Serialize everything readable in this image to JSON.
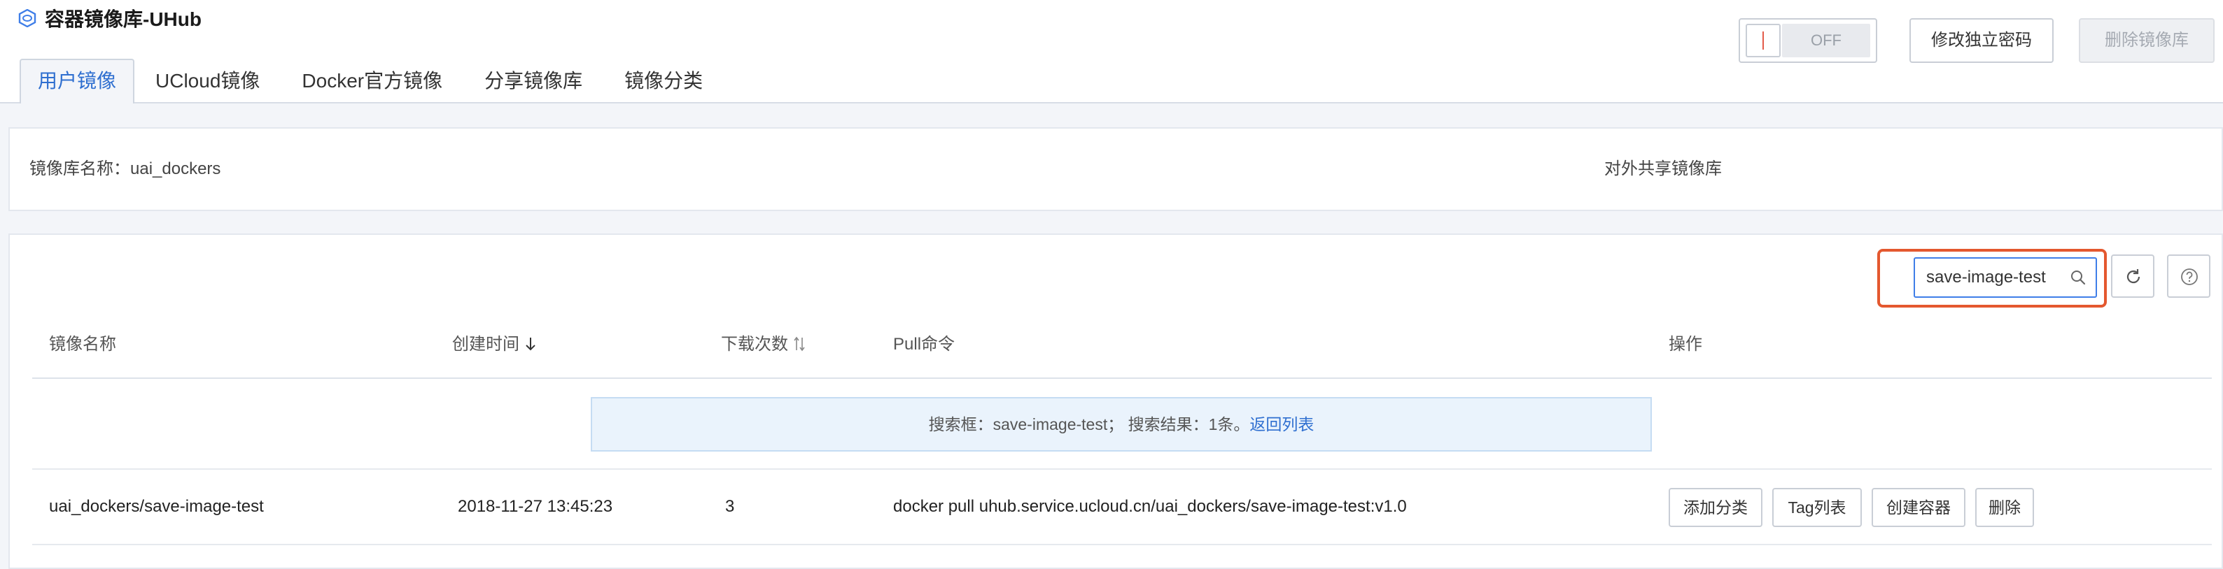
{
  "app": {
    "title": "容器镜像库-UHub"
  },
  "tabs": [
    {
      "label": "用户镜像",
      "active": true
    },
    {
      "label": "UCloud镜像"
    },
    {
      "label": "Docker官方镜像"
    },
    {
      "label": "分享镜像库"
    },
    {
      "label": "镜像分类"
    }
  ],
  "repo": {
    "name_label": "镜像库名称：uai_dockers",
    "share_label": "对外共享镜像库",
    "toggle_state": "OFF",
    "change_password_label": "修改独立密码",
    "delete_repo_label": "删除镜像库"
  },
  "search": {
    "value": "save-image-test",
    "icon": "search-icon"
  },
  "toolbar": {
    "refresh_icon": "refresh-icon",
    "help_icon": "help-icon"
  },
  "table": {
    "headers": {
      "name": "镜像名称",
      "created": "创建时间",
      "downloads": "下载次数",
      "pull": "Pull命令",
      "actions": "操作"
    },
    "notice": {
      "text": "搜索框：save-image-test；  搜索结果：1条。",
      "link": "返回列表"
    },
    "rows": [
      {
        "name": "uai_dockers/save-image-test",
        "created": "2018-11-27 13:45:23",
        "downloads": "3",
        "pull": "docker pull uhub.service.ucloud.cn/uai_dockers/save-image-test:v1.0",
        "actions": [
          "添加分类",
          "Tag列表",
          "创建容器",
          "删除"
        ]
      }
    ]
  },
  "colors": {
    "accent": "#2f6fd0",
    "highlight": "#e4582f",
    "toggle_mark": "#e35b49"
  }
}
